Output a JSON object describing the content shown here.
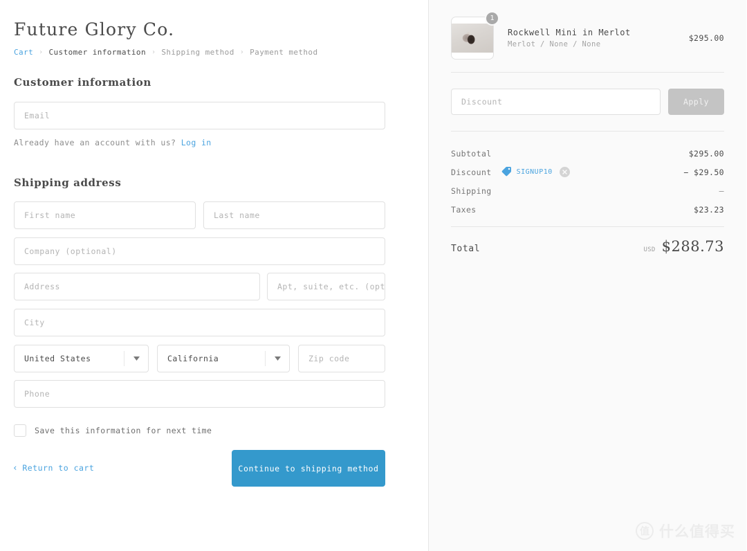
{
  "store": {
    "name": "Future Glory Co."
  },
  "breadcrumb": {
    "items": [
      {
        "label": "Cart",
        "state": "link"
      },
      {
        "label": "Customer information",
        "state": "active"
      },
      {
        "label": "Shipping method",
        "state": "muted"
      },
      {
        "label": "Payment method",
        "state": "muted"
      }
    ],
    "separator": "›"
  },
  "customer_information": {
    "heading": "Customer information",
    "email_placeholder": "Email",
    "email_value": "",
    "account_prompt": "Already have an account with us?",
    "login_label": "Log in"
  },
  "shipping_address": {
    "heading": "Shipping address",
    "first_name_placeholder": "First name",
    "last_name_placeholder": "Last name",
    "company_placeholder": "Company (optional)",
    "address_placeholder": "Address",
    "apt_placeholder": "Apt, suite, etc. (optional)",
    "city_placeholder": "City",
    "country_value": "United States",
    "state_value": "California",
    "zip_placeholder": "Zip code",
    "phone_placeholder": "Phone",
    "save_info_label": "Save this information for next time",
    "save_info_checked": false
  },
  "actions": {
    "return_to_cart": "Return to cart",
    "return_chevron": "‹",
    "continue_label": "Continue to shipping method",
    "continue_color": "#3499cc"
  },
  "summary": {
    "line_items": [
      {
        "title": "Rockwell Mini in Merlot",
        "variant": "Merlot / None / None",
        "price": "$295.00",
        "quantity": "1",
        "image_name": "product-thumbnail-rockwell-mini"
      }
    ],
    "discount": {
      "placeholder": "Discount",
      "value": "",
      "apply_label": "Apply",
      "apply_disabled": true
    },
    "totals": [
      {
        "label": "Subtotal",
        "value": "$295.00",
        "code": null
      },
      {
        "label": "Discount",
        "value": "− $29.50",
        "code": "SIGNUP10"
      },
      {
        "label": "Shipping",
        "value": "—",
        "code": null
      },
      {
        "label": "Taxes",
        "value": "$23.23",
        "code": null
      }
    ],
    "grand_total": {
      "label": "Total",
      "currency": "USD",
      "amount": "$288.73"
    }
  },
  "watermark": {
    "badge": "值",
    "text": "什么值得买"
  },
  "colors": {
    "accent_blue": "#4aa3df",
    "button_blue": "#3499cc",
    "disabled_gray": "#c4c4c4",
    "panel_bg": "#fafafa",
    "border": "#e0e0e0"
  }
}
